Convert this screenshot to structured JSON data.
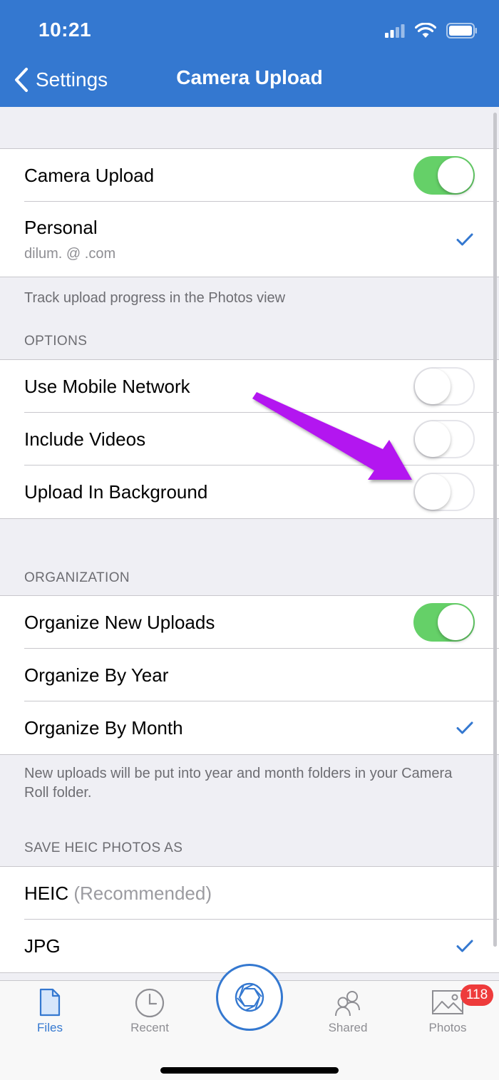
{
  "status_bar": {
    "time": "10:21"
  },
  "nav": {
    "back_label": "Settings",
    "title": "Camera Upload"
  },
  "account": {
    "camera_upload_label": "Camera Upload",
    "camera_upload_on": true,
    "personal_label": "Personal",
    "personal_email": "dilum.           @      .com",
    "personal_selected": true
  },
  "account_footer": "Track upload progress in the Photos view",
  "options": {
    "header": "OPTIONS",
    "items": [
      {
        "label": "Use Mobile Network",
        "on": false
      },
      {
        "label": "Include Videos",
        "on": false
      },
      {
        "label": "Upload In Background",
        "on": false
      }
    ]
  },
  "organization": {
    "header": "ORGANIZATION",
    "organize_new_label": "Organize New Uploads",
    "organize_new_on": true,
    "by_year_label": "Organize By Year",
    "by_month_label": "Organize By Month",
    "selected": "Organize By Month",
    "footer": "New uploads will be put into year and month folders in your Camera Roll folder."
  },
  "heic": {
    "header": "SAVE HEIC PHOTOS AS",
    "heic_label": "HEIC",
    "heic_note": "(Recommended)",
    "jpg_label": "JPG",
    "selected": "JPG"
  },
  "tabbar": {
    "files": "Files",
    "recent": "Recent",
    "shared": "Shared",
    "photos": "Photos",
    "photos_badge": "118"
  },
  "colors": {
    "nav_blue": "#3478d0",
    "toggle_green": "#65d068",
    "check_blue": "#3478d0",
    "arrow_purple": "#b313f0",
    "badge_red": "#ee3b3b"
  }
}
